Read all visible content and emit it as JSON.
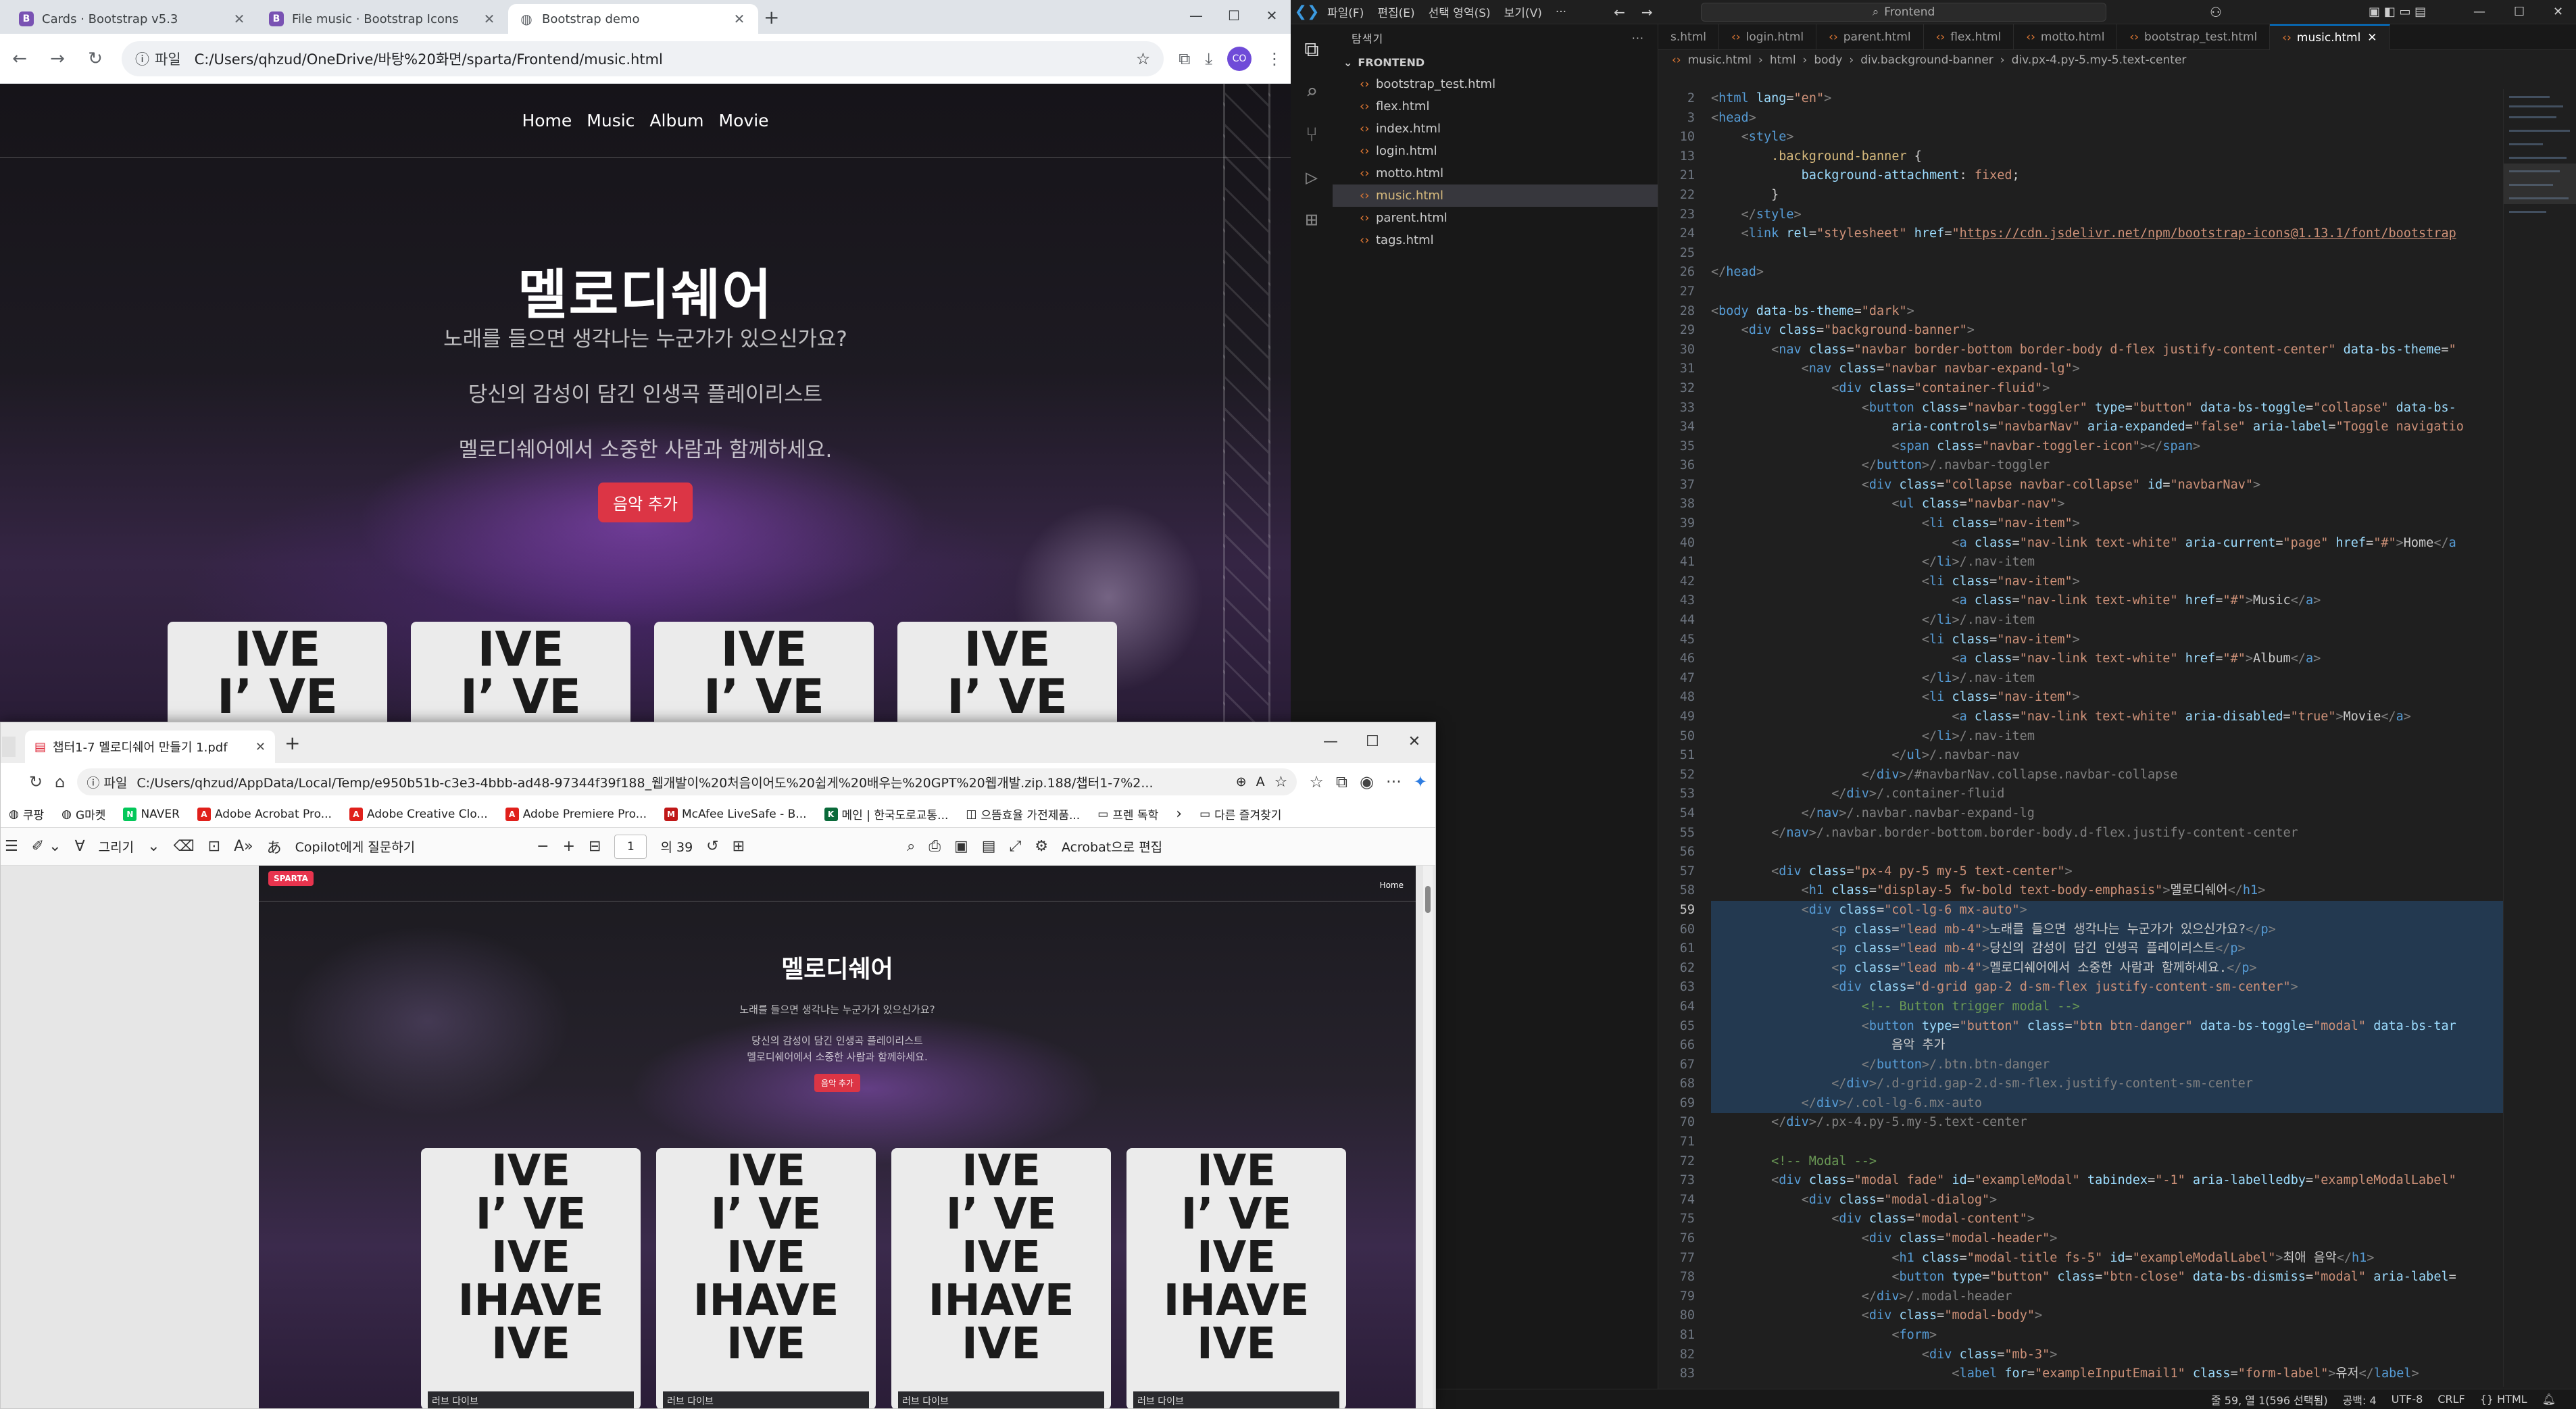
{
  "browser1": {
    "tabs": [
      {
        "label": "Cards · Bootstrap v5.3",
        "icon": "bootstrap-icon",
        "color": "#7952b3"
      },
      {
        "label": "File music · Bootstrap Icons",
        "icon": "bootstrap-icon",
        "color": "#7952b3"
      },
      {
        "label": "Bootstrap demo",
        "icon": "globe-icon",
        "color": "#5f6368"
      }
    ],
    "url_prefix": "파일",
    "url": "C:/Users/qhzud/OneDrive/바탕%20화면/sparta/Frontend/music.html",
    "profile": "CO",
    "page": {
      "nav": [
        "Home",
        "Music",
        "Album",
        "Movie"
      ],
      "title": "멜로디쉐어",
      "leads": [
        "노래를 들으면 생각나는 누군가가 있으신가요?",
        "당신의 감성이 담긴 인생곡 플레이리스트",
        "멜로디쉐어에서 소중한 사람과 함께하세요."
      ],
      "button": "음악 추가",
      "album_lines": [
        "IVE",
        "I’  VE",
        "IVE"
      ]
    }
  },
  "vscode": {
    "menu": [
      "파일(F)",
      "편집(E)",
      "선택 영역(S)",
      "보기(V)",
      "···"
    ],
    "search": "Frontend",
    "explorer_title": "탐색기",
    "project": "FRONTEND",
    "files": [
      "bootstrap_test.html",
      "flex.html",
      "index.html",
      "login.html",
      "motto.html",
      "music.html",
      "parent.html",
      "tags.html"
    ],
    "selected_file": "music.html",
    "tabs": [
      "s.html",
      "login.html",
      "parent.html",
      "flex.html",
      "motto.html",
      "bootstrap_test.html",
      "music.html"
    ],
    "breadcrumb": [
      "music.html",
      "html",
      "body",
      "div.background-banner",
      "div.px-4.py-5.my-5.text-center"
    ],
    "status": [
      "줄 59, 열 1(596 선택됨)",
      "공백: 4",
      "UTF-8",
      "CRLF",
      "{} HTML"
    ]
  },
  "pdf": {
    "tab": "챕터1-7 멜로디쉐어 만들기 1.pdf",
    "url_prefix": "파일",
    "url": "C:/Users/qhzud/AppData/Local/Temp/e950b51b-c3e3-4bbb-ad48-97344f39f188_웹개발이%20처음이어도%20쉽게%20배우는%20GPT%20웹개발.zip.188/챕터1-7%2...",
    "favorites": [
      "쿠팡",
      "G마켓",
      "NAVER",
      "Adobe Acrobat Pro...",
      "Adobe Creative Clo...",
      "Adobe Premiere Pro...",
      "McAfee LiveSafe - B...",
      "메인 | 한국도로교통...",
      "으뜸효율 가전제품...",
      "프렌 독학"
    ],
    "favorites_more": "다른 즐겨찾기",
    "toolbar": {
      "draw": "그리기",
      "copilot": "Copilot에게 질문하기",
      "page": "1",
      "of": "의 39",
      "acrobat": "Acrobat으로 편집"
    },
    "page": {
      "logo": "SPARTA",
      "nav": "Home",
      "title": "멜로디쉐어",
      "lead1": "노래를 들으면 생각나는 누군가가 있으신가요?",
      "lead2": "당신의 감성이 담긴 인생곡 플레이리스트",
      "lead3": "멜로디쉐어에서 소중한 사람과 함께하세요.",
      "button": "음악 추가",
      "album_lines": [
        "IVE",
        "I’  VE",
        "IVE",
        "IHAVE",
        "IVE"
      ],
      "caption": "러브 다이브"
    }
  }
}
